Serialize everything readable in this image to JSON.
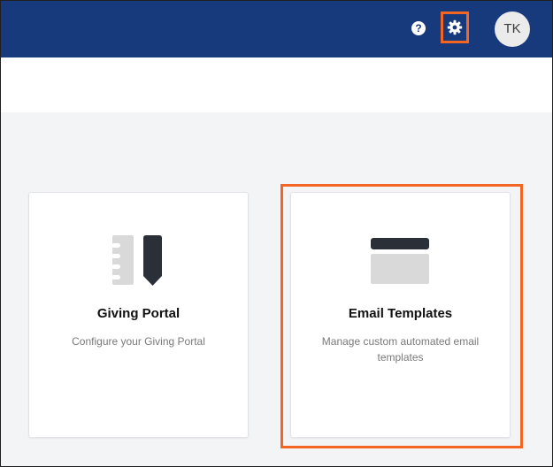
{
  "header": {
    "help_icon_glyph": "?",
    "avatar_initials": "TK",
    "bar_color": "#173a7d",
    "highlight_color": "#f26522"
  },
  "cards": [
    {
      "title": "Giving Portal",
      "description": "Configure your Giving Portal",
      "icon": "notebook-pen-icon"
    },
    {
      "title": "Email Templates",
      "description": "Manage custom automated email templates",
      "icon": "email-template-icon"
    }
  ]
}
